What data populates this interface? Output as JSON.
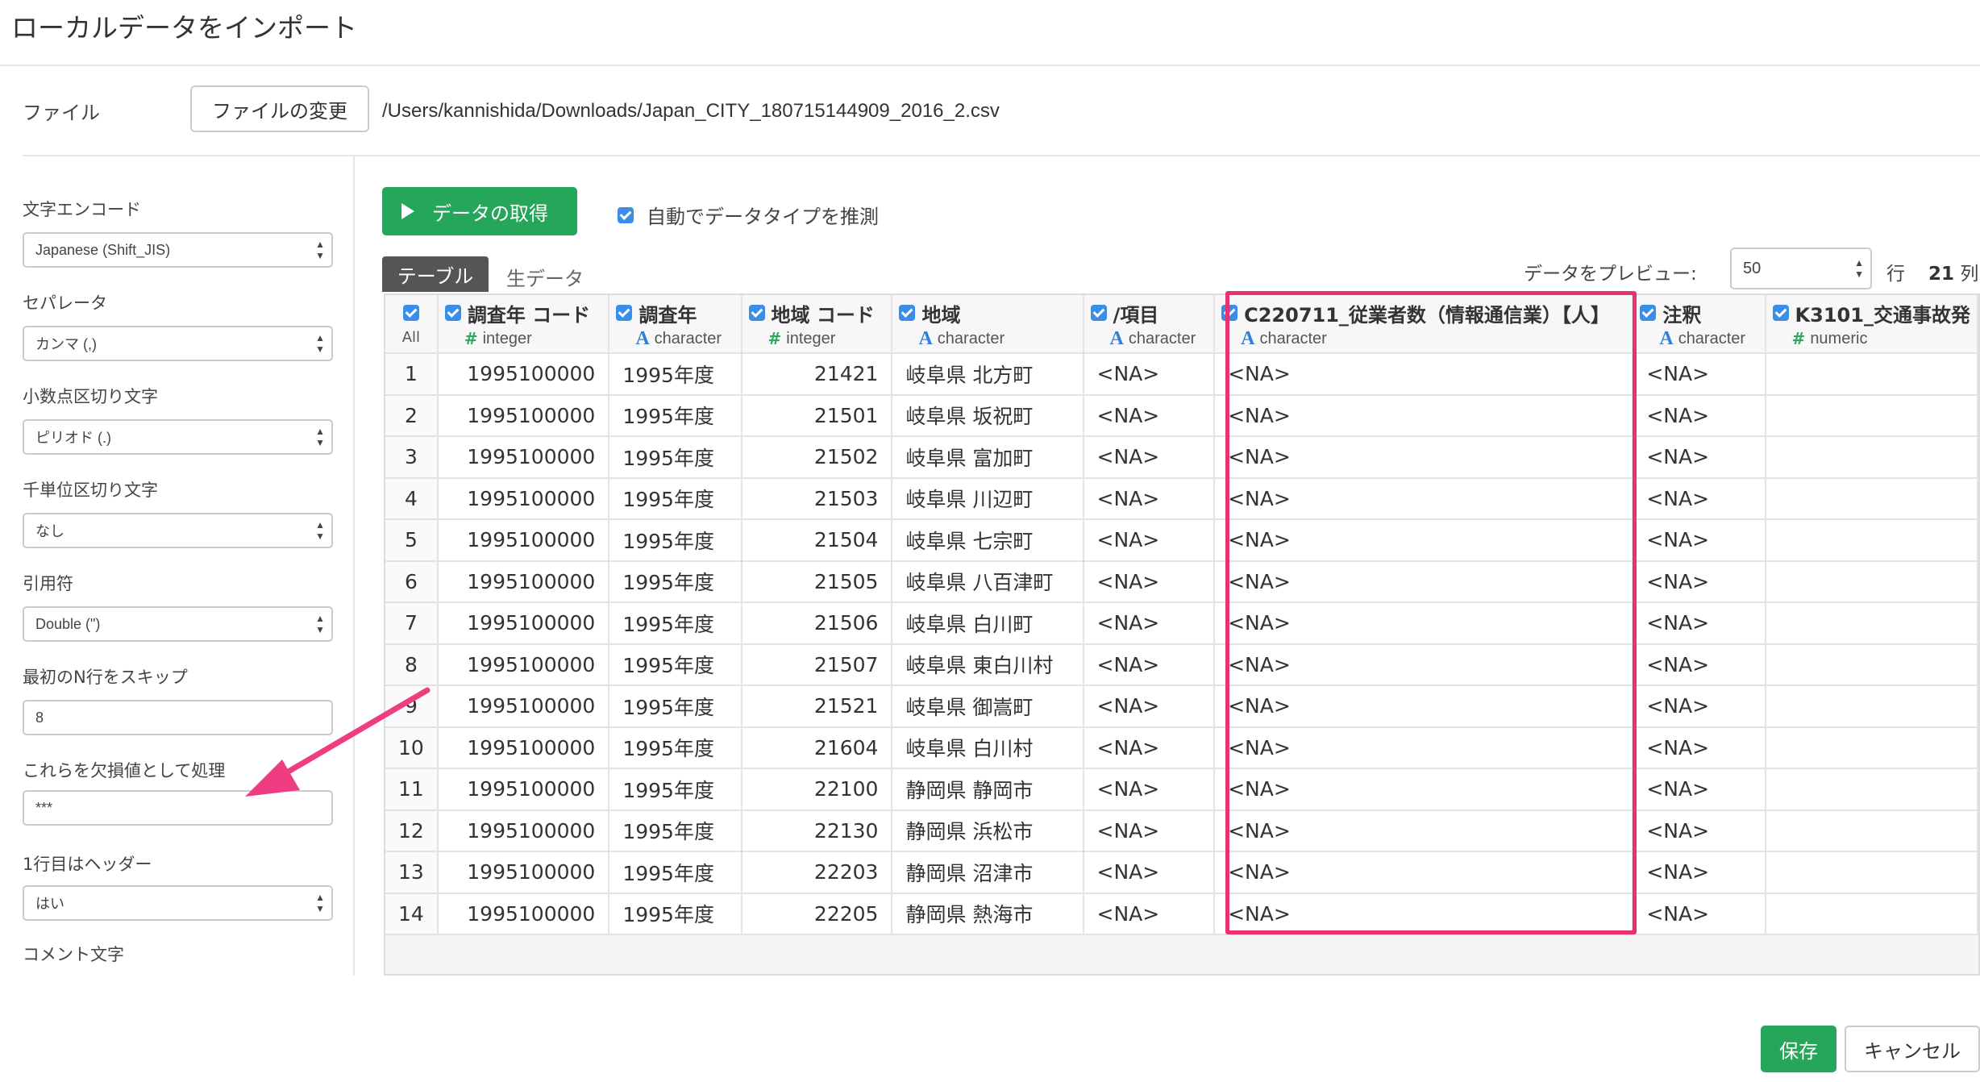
{
  "dialog": {
    "title": "ローカルデータをインポート"
  },
  "file": {
    "label": "ファイル",
    "change_button": "ファイルの変更",
    "path": "/Users/kannishida/Downloads/Japan_CITY_180715144909_2016_2.csv"
  },
  "options": {
    "encoding": {
      "label": "文字エンコード",
      "value": "Japanese (Shift_JIS)"
    },
    "separator": {
      "label": "セパレータ",
      "value": "カンマ (,)"
    },
    "decimal": {
      "label": "小数点区切り文字",
      "value": "ピリオド (.)"
    },
    "thousands": {
      "label": "千単位区切り文字",
      "value": "なし"
    },
    "quote": {
      "label": "引用符",
      "value": "Double (\")"
    },
    "skip": {
      "label": "最初のN行をスキップ",
      "value": "8"
    },
    "na": {
      "label": "これらを欠損値として処理",
      "value": "***"
    },
    "header": {
      "label": "1行目はヘッダー",
      "value": "はい"
    },
    "comment": {
      "label": "コメント文字"
    }
  },
  "toolbar": {
    "fetch_button": "データの取得",
    "auto_detect_label": "自動でデータタイプを推測"
  },
  "tabs": {
    "table": "テーブル",
    "raw": "生データ"
  },
  "preview": {
    "label": "データをプレビュー:",
    "value": "50",
    "rows_suffix": "行",
    "col_count": "21",
    "cols_suffix": "列"
  },
  "grid": {
    "all_label": "All",
    "columns": [
      {
        "name": "調査年 コード",
        "type": "integer",
        "icon": "number-icon"
      },
      {
        "name": "調査年",
        "type": "character",
        "icon": "character-icon"
      },
      {
        "name": "地域 コード",
        "type": "integer",
        "icon": "number-icon"
      },
      {
        "name": "地域",
        "type": "character",
        "icon": "character-icon"
      },
      {
        "name": "/項目",
        "type": "character",
        "icon": "character-icon"
      },
      {
        "name": "C220711_従業者数（情報通信業）【人】",
        "type": "character",
        "icon": "character-icon"
      },
      {
        "name": "注釈",
        "type": "character",
        "icon": "character-icon"
      },
      {
        "name": "K3101_交通事故発",
        "type": "numeric",
        "icon": "number-icon"
      }
    ],
    "rows": [
      [
        "1",
        "1995100000",
        "1995年度",
        "21421",
        "岐阜県 北方町",
        "<NA>",
        "<NA>",
        "<NA>",
        ""
      ],
      [
        "2",
        "1995100000",
        "1995年度",
        "21501",
        "岐阜県 坂祝町",
        "<NA>",
        "<NA>",
        "<NA>",
        ""
      ],
      [
        "3",
        "1995100000",
        "1995年度",
        "21502",
        "岐阜県 富加町",
        "<NA>",
        "<NA>",
        "<NA>",
        ""
      ],
      [
        "4",
        "1995100000",
        "1995年度",
        "21503",
        "岐阜県 川辺町",
        "<NA>",
        "<NA>",
        "<NA>",
        ""
      ],
      [
        "5",
        "1995100000",
        "1995年度",
        "21504",
        "岐阜県 七宗町",
        "<NA>",
        "<NA>",
        "<NA>",
        ""
      ],
      [
        "6",
        "1995100000",
        "1995年度",
        "21505",
        "岐阜県 八百津町",
        "<NA>",
        "<NA>",
        "<NA>",
        ""
      ],
      [
        "7",
        "1995100000",
        "1995年度",
        "21506",
        "岐阜県 白川町",
        "<NA>",
        "<NA>",
        "<NA>",
        ""
      ],
      [
        "8",
        "1995100000",
        "1995年度",
        "21507",
        "岐阜県 東白川村",
        "<NA>",
        "<NA>",
        "<NA>",
        ""
      ],
      [
        "9",
        "1995100000",
        "1995年度",
        "21521",
        "岐阜県 御嵩町",
        "<NA>",
        "<NA>",
        "<NA>",
        ""
      ],
      [
        "10",
        "1995100000",
        "1995年度",
        "21604",
        "岐阜県 白川村",
        "<NA>",
        "<NA>",
        "<NA>",
        ""
      ],
      [
        "11",
        "1995100000",
        "1995年度",
        "22100",
        "静岡県 静岡市",
        "<NA>",
        "<NA>",
        "<NA>",
        ""
      ],
      [
        "12",
        "1995100000",
        "1995年度",
        "22130",
        "静岡県 浜松市",
        "<NA>",
        "<NA>",
        "<NA>",
        ""
      ],
      [
        "13",
        "1995100000",
        "1995年度",
        "22203",
        "静岡県 沼津市",
        "<NA>",
        "<NA>",
        "<NA>",
        ""
      ],
      [
        "14",
        "1995100000",
        "1995年度",
        "22205",
        "静岡県 熱海市",
        "<NA>",
        "<NA>",
        "<NA>",
        ""
      ]
    ]
  },
  "annotations": {
    "highlight_color": "#e8336f",
    "arrow_color": "#ee3d80"
  },
  "footer": {
    "save_button": "保存",
    "cancel_button": "キャンセル"
  },
  "colors": {
    "accent_green": "#26a65b",
    "checkbox_blue": "#3b8ee8"
  }
}
